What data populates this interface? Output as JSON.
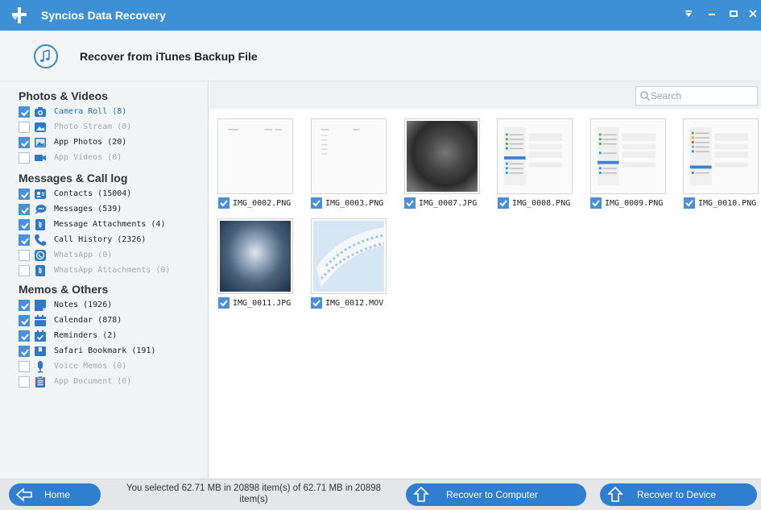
{
  "app": {
    "title": "Syncios Data Recovery"
  },
  "header": {
    "title": "Recover from iTunes Backup File"
  },
  "search": {
    "placeholder": "Search"
  },
  "sidebar": {
    "sections": [
      {
        "title": "Photos & Videos",
        "items": [
          {
            "label": "Camera Roll (8)",
            "checked": true,
            "state": "active",
            "icon": "camera-icon"
          },
          {
            "label": "Photo Stream (0)",
            "checked": false,
            "state": "disabled",
            "icon": "photo-stream-icon"
          },
          {
            "label": "App Photos (20)",
            "checked": true,
            "state": "normal",
            "icon": "image-icon"
          },
          {
            "label": "App Videos (0)",
            "checked": false,
            "state": "disabled",
            "icon": "video-icon"
          }
        ]
      },
      {
        "title": "Messages & Call log",
        "items": [
          {
            "label": "Contacts (15004)",
            "checked": true,
            "state": "normal",
            "icon": "contacts-icon"
          },
          {
            "label": "Messages (539)",
            "checked": true,
            "state": "normal",
            "icon": "message-icon"
          },
          {
            "label": "Message Attachments (4)",
            "checked": true,
            "state": "normal",
            "icon": "attachment-icon"
          },
          {
            "label": "Call History (2326)",
            "checked": true,
            "state": "normal",
            "icon": "phone-icon"
          },
          {
            "label": "WhatsApp (0)",
            "checked": false,
            "state": "disabled",
            "icon": "whatsapp-icon"
          },
          {
            "label": "WhatsApp Attachments (0)",
            "checked": false,
            "state": "disabled",
            "icon": "whatsapp-attachment-icon"
          }
        ]
      },
      {
        "title": "Memos & Others",
        "items": [
          {
            "label": "Notes (1926)",
            "checked": true,
            "state": "normal",
            "icon": "notes-icon"
          },
          {
            "label": "Calendar (878)",
            "checked": true,
            "state": "normal",
            "icon": "calendar-icon"
          },
          {
            "label": "Reminders (2)",
            "checked": true,
            "state": "normal",
            "icon": "reminders-icon"
          },
          {
            "label": "Safari Bookmark (191)",
            "checked": true,
            "state": "normal",
            "icon": "bookmark-icon"
          },
          {
            "label": "Voice Memos (0)",
            "checked": false,
            "state": "disabled",
            "icon": "microphone-icon"
          },
          {
            "label": "App Document (0)",
            "checked": false,
            "state": "disabled",
            "icon": "document-icon"
          }
        ]
      }
    ]
  },
  "files": [
    {
      "name": "IMG_0002.PNG",
      "kind": "screenshot-blank",
      "checked": true
    },
    {
      "name": "IMG_0003.PNG",
      "kind": "screenshot-blank",
      "checked": true
    },
    {
      "name": "IMG_0007.JPG",
      "kind": "photo-dark",
      "checked": true
    },
    {
      "name": "IMG_0008.PNG",
      "kind": "screenshot-settings",
      "checked": true
    },
    {
      "name": "IMG_0009.PNG",
      "kind": "screenshot-settings",
      "checked": true
    },
    {
      "name": "IMG_0010.PNG",
      "kind": "screenshot-settings",
      "checked": true
    },
    {
      "name": "IMG_0011.JPG",
      "kind": "photo-blue",
      "checked": true
    },
    {
      "name": "IMG_0012.MOV",
      "kind": "video-film",
      "checked": true
    }
  ],
  "footer": {
    "home_label": "Home",
    "status_line1": "You selected 62.71 MB in 20898 item(s) of 62.71 MB in 20898",
    "status_line2": "item(s)",
    "recover_computer_label": "Recover to Computer",
    "recover_device_label": "Recover to Device"
  },
  "colors": {
    "accent": "#3d8fd6",
    "checkbox": "#4a90d9",
    "button": "#2f7fd0"
  }
}
